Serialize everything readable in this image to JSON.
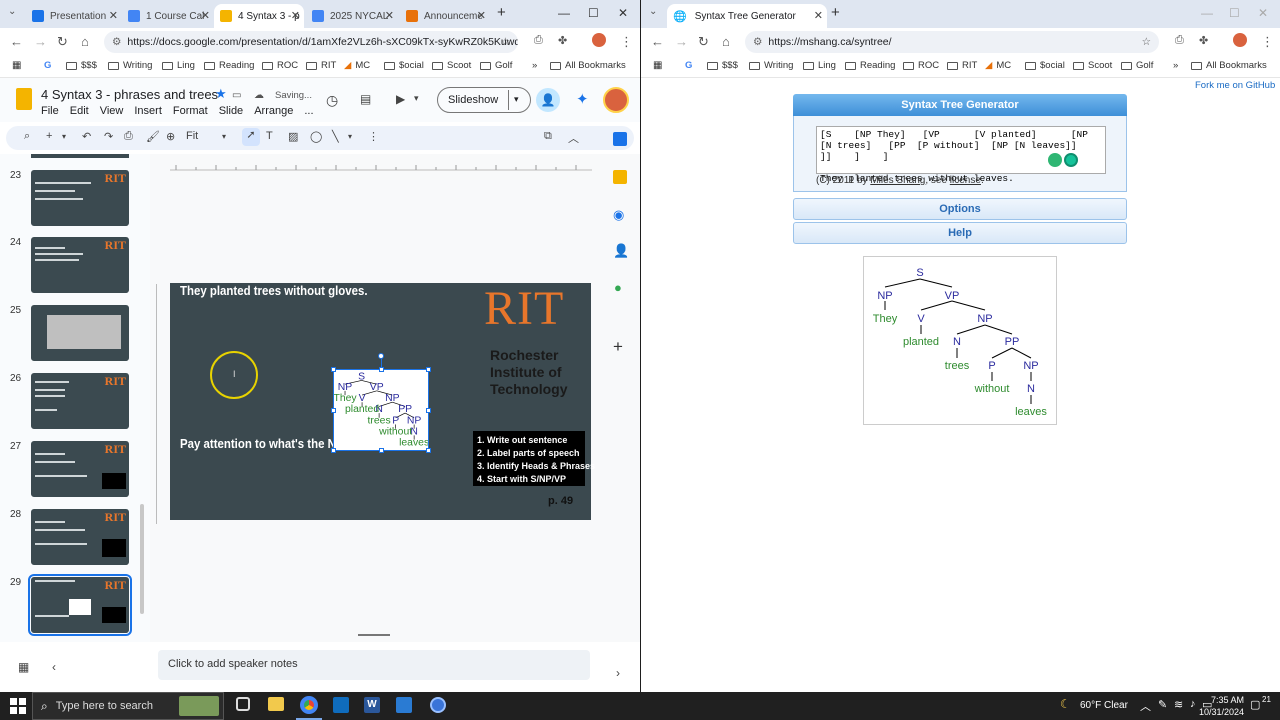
{
  "left": {
    "tabs": [
      {
        "label": "Presentation",
        "color": "#1a73e8"
      },
      {
        "label": "1 Course Cal",
        "color": "#4285f4"
      },
      {
        "label": "4 Syntax 3 - p",
        "color": "#f4b400"
      },
      {
        "label": "2025 NYCAL",
        "color": "#4285f4"
      },
      {
        "label": "Announceme",
        "color": "#e8710a"
      }
    ],
    "url": "https://docs.google.com/presentation/d/1amXfe2VLz6h-sXC09kTx-syKwRZ0k5KuwqPe...",
    "bookmarks": [
      "$$$",
      "Writing",
      "Ling",
      "Reading",
      "ROC",
      "RIT",
      "MC",
      "$ocial",
      "Scoot",
      "Golf"
    ],
    "all_bookmarks": "All Bookmarks",
    "doc_title": "4 Syntax 3 - phrases and trees",
    "menu": [
      "File",
      "Edit",
      "View",
      "Insert",
      "Format",
      "Slide",
      "Arrange",
      "..."
    ],
    "saving": "Saving...",
    "slideshow": "Slideshow",
    "fit": "Fit",
    "slide_numbers": [
      "23",
      "24",
      "25",
      "26",
      "27",
      "28",
      "29"
    ],
    "slide": {
      "title": "They planted trees without gloves.",
      "pay": "Pay attention to what's the NP",
      "rit": "RIT",
      "rit_sub": [
        "Rochester",
        "Institute of",
        "Technology"
      ],
      "steps": [
        "1.  Write out sentence",
        "2.  Label parts of speech",
        "3.  Identify Heads & Phrases",
        "4.  Start with S/NP/VP"
      ],
      "page": "p. 49"
    },
    "notes": "Click to add speaker notes"
  },
  "right": {
    "tab": "Syntax Tree Generator",
    "url": "https://mshang.ca/syntree/",
    "fork": "Fork me on GitHub",
    "panel_title": "Syntax Tree Generator",
    "input": "[S    [NP They]   [VP      [V planted]      [NP   [N trees]   [PP  [P without]  [NP [N leaves]]   ]]    ]    ]\n\nThey planted trees without leaves.",
    "copyright_pre": "(C) 2011 by ",
    "author": "Miles Shang",
    "copyright_mid": ", see ",
    "license": "license",
    "copyright_post": ".",
    "options": "Options",
    "help": "Help",
    "tree": {
      "labels": [
        "S",
        "NP",
        "VP",
        "V",
        "NP",
        "N",
        "PP",
        "P",
        "NP",
        "N"
      ],
      "words": [
        "They",
        "planted",
        "trees",
        "without",
        "leaves"
      ]
    }
  },
  "taskbar": {
    "search": "Type here to search",
    "weather": "60°F  Clear",
    "time": "7:35 AM",
    "date": "10/31/2024",
    "notif": "21"
  },
  "colors": {
    "accent": "#1a73e8",
    "rit_orange": "#e8762b",
    "slide_bg": "#3b494f",
    "tree_label": "#2b2b9e",
    "tree_word": "#2e8b2e"
  }
}
